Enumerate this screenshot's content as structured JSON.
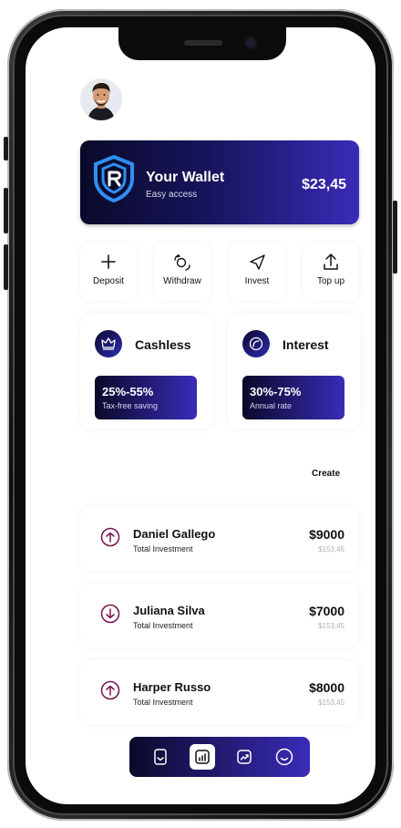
{
  "wallet": {
    "title": "Your Wallet",
    "subtitle": "Easy access",
    "amount": "$23,45"
  },
  "actions": [
    {
      "label": "Deposit",
      "icon": "plus-icon"
    },
    {
      "label": "Withdraw",
      "icon": "withdraw-icon"
    },
    {
      "label": "Invest",
      "icon": "send-icon"
    },
    {
      "label": "Top up",
      "icon": "upload-icon"
    }
  ],
  "features": [
    {
      "title": "Cashless",
      "icon": "crown-icon",
      "rate": "25%-55%",
      "note": "Tax-free saving"
    },
    {
      "title": "Interest",
      "icon": "leaf-icon",
      "rate": "30%-75%",
      "note": "Annual rate"
    }
  ],
  "list": {
    "create_label": "Create"
  },
  "investments": [
    {
      "name": "Daniel Gallego",
      "label": "Total Investment",
      "amount": "$9000",
      "sub": "$153,45",
      "direction": "up"
    },
    {
      "name": "Juliana Silva",
      "label": "Total Investment",
      "amount": "$7000",
      "sub": "$153,45",
      "direction": "down"
    },
    {
      "name": "Harper Russo",
      "label": "Total Investment",
      "amount": "$8000",
      "sub": "$153,45",
      "direction": "up"
    }
  ],
  "tabs": [
    {
      "icon": "bookmark-icon",
      "active": false
    },
    {
      "icon": "chart-icon",
      "active": true
    },
    {
      "icon": "trend-icon",
      "active": false
    },
    {
      "icon": "profile-icon",
      "active": false
    }
  ],
  "colors": {
    "accent_dark": "#0a0a2a",
    "accent": "#3a2bb8",
    "arrow_purple": "#7a1450"
  }
}
